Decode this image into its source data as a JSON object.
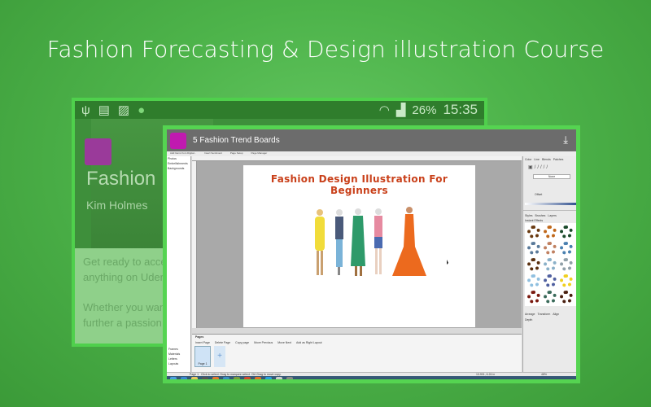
{
  "headline": "Fashion Forecasting & Design illustration Course",
  "phone": {
    "status_battery": "26%",
    "status_time": "15:35",
    "title": "Fashion",
    "author": "Kim Holmes",
    "body_lines": [
      "Get ready to acce",
      "anything on Uder",
      "Whether you wan",
      "further a passion,"
    ]
  },
  "window": {
    "title": "5  Fashion Trend Boards",
    "menu": [
      "Add Items from Digital...",
      "Insert Sentiment",
      "Page Setup",
      "Page Manager"
    ],
    "left_items": [
      "Photos",
      "Embellishments",
      "Backgrounds"
    ],
    "left_bottom": [
      "Frames",
      "Materials",
      "Letters",
      "Layouts"
    ],
    "page_title": "Fashion Design Illustration For Beginners",
    "right_tabs": [
      "Color",
      "Line",
      "Blends",
      "Patches"
    ],
    "line_style": "None",
    "offset_label": "Offset",
    "style_tabs": [
      "Styles",
      "Brushes",
      "Layers"
    ],
    "effects_label": "Instant Effects",
    "arrange_tabs": [
      "Arrange",
      "Transform",
      "Align"
    ],
    "depth_label": "Depth",
    "pages_label": "Pages",
    "page_buttons": [
      "Insert Page",
      "Delete Page",
      "Copy page",
      "Move Previous",
      "Move Next",
      "Add as Right Layout"
    ],
    "page_thumb_label": "Page 1",
    "page_nav": "Page 1",
    "status_text": "Click to select. Drag to marquee select. Ctrl-Drag to move copy.",
    "coords": "13.901, 6.24 in",
    "zoom": "48%"
  },
  "colors": {
    "accent": "#55d451",
    "title_red": "#c9401a"
  }
}
